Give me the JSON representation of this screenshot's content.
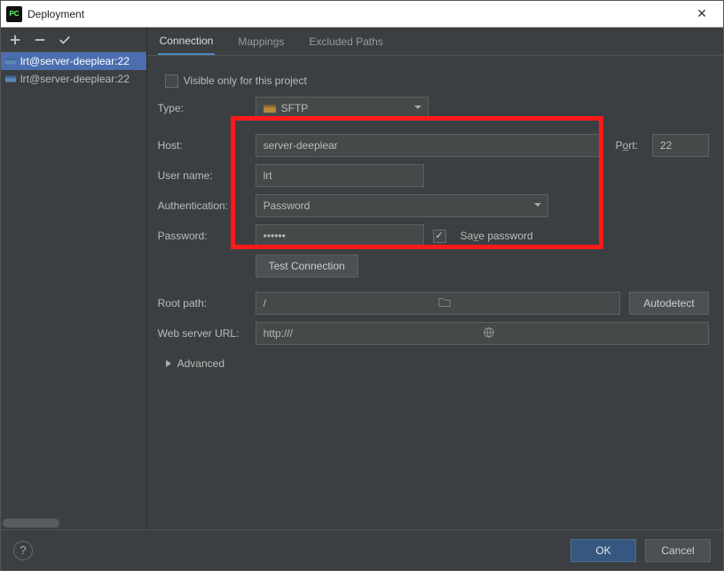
{
  "window": {
    "title": "Deployment"
  },
  "sidebar": {
    "items": [
      {
        "label": "lrt@server-deeplear:22"
      },
      {
        "label": "lrt@server-deeplear:22"
      }
    ]
  },
  "tabs": [
    {
      "label": "Connection"
    },
    {
      "label": "Mappings"
    },
    {
      "label": "Excluded Paths"
    }
  ],
  "form": {
    "visible_only_label": "Visible only for this project",
    "type_label": "Type:",
    "type_value": "SFTP",
    "host_label": "Host:",
    "host_value": "server-deeplear",
    "port_label": "Port:",
    "port_value": "22",
    "user_label": "User name:",
    "user_value": "lrt",
    "auth_label": "Authentication:",
    "auth_value": "Password",
    "password_label": "Password:",
    "password_value": "••••••",
    "save_password_label": "Save password",
    "test_connection_label": "Test Connection",
    "root_label": "Root path:",
    "root_value": "/",
    "autodetect_label": "Autodetect",
    "url_label": "Web server URL:",
    "url_value": "http:///",
    "advanced_label": "Advanced"
  },
  "buttons": {
    "ok": "OK",
    "cancel": "Cancel"
  }
}
